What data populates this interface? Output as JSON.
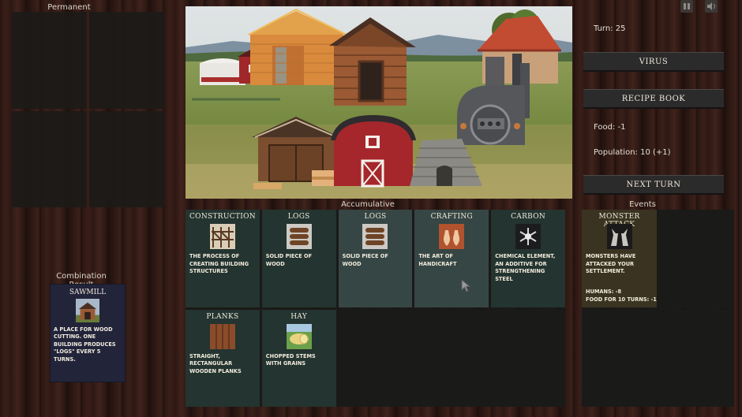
{
  "permanent": {
    "label": "Permanent"
  },
  "combination": {
    "label": "Combination Result",
    "card": {
      "title": "SAWMILL",
      "desc": "A place for wood cutting. One building produces \"logs\" every 5 turns.",
      "icon": "sawmill-icon"
    }
  },
  "right": {
    "turn": "Turn: 25",
    "virus_button": "VIRUS",
    "recipe_button": "RECIPE BOOK",
    "food": "Food: -1",
    "population": "Population: 10 (+1)",
    "next_turn_button": "NEXT TURN"
  },
  "top_icons": [
    "pause-icon",
    "sound-icon"
  ],
  "accumulative": {
    "label": "Accumulative",
    "cards": [
      {
        "title": "CONSTRUCTION",
        "desc": "The process of creating building structures",
        "icon": "scaffold-icon"
      },
      {
        "title": "LOGS",
        "desc": "Solid piece of wood",
        "icon": "logs-icon"
      },
      {
        "title": "LOGS",
        "desc": "Solid piece of wood",
        "icon": "logs-icon",
        "selected": true
      },
      {
        "title": "CRAFTING",
        "desc": "The art of handicraft",
        "icon": "vases-icon",
        "selected": true
      },
      {
        "title": "CARBON",
        "desc": "Chemical element, an additive for strengthening steel",
        "icon": "carbon-icon"
      },
      {
        "title": "PLANKS",
        "desc": "Straight, rectangular wooden planks",
        "icon": "planks-icon"
      },
      {
        "title": "HAY",
        "desc": "Chopped stems with grains",
        "icon": "hay-icon"
      }
    ]
  },
  "events": {
    "label": "Events",
    "cards": [
      {
        "title": "MONSTER ATTACK",
        "desc": "Monsters have attacked your settlement.",
        "icon": "monster-icon",
        "stat1": "Humans: -8",
        "stat2": "Food for 10 turns: -1"
      }
    ]
  },
  "colors": {
    "card_bg": "#243430",
    "card_selected": "#364644",
    "event_card": "#3a3322",
    "combo_card": "#22243a",
    "button_bg": "#2c2b2b"
  }
}
